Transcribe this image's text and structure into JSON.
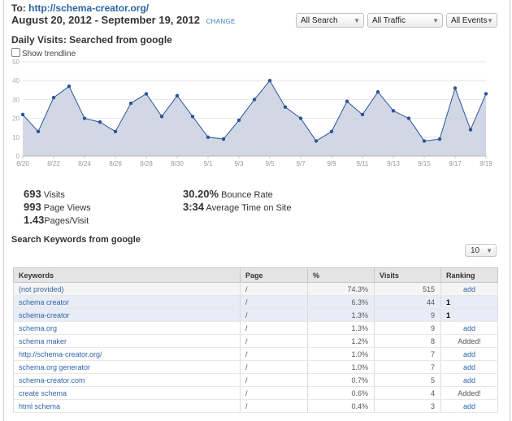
{
  "header": {
    "to_label": "To:",
    "site_url": "http://schema-creator.org/",
    "date_range": "August 20, 2012 - September 19, 2012",
    "change_label": "CHANGE"
  },
  "filters": [
    {
      "value": "All Search"
    },
    {
      "value": "All Traffic"
    },
    {
      "value": "All Events"
    }
  ],
  "chart_section": {
    "title": "Daily Visits: Searched from google",
    "trendline_label": "Show trendline"
  },
  "chart_data": {
    "type": "area",
    "title": "Daily Visits: Searched from google",
    "xlabel": "",
    "ylabel": "",
    "ylim": [
      0,
      50
    ],
    "yticks": [
      0,
      10,
      20,
      30,
      40,
      50
    ],
    "xtick_labels": [
      "8/20",
      "8/22",
      "8/24",
      "8/26",
      "8/28",
      "8/30",
      "9/1",
      "9/3",
      "9/5",
      "9/7",
      "9/9",
      "9/11",
      "9/13",
      "9/15",
      "9/17",
      "9/19"
    ],
    "x": [
      "8/20",
      "8/21",
      "8/22",
      "8/23",
      "8/24",
      "8/25",
      "8/26",
      "8/27",
      "8/28",
      "8/29",
      "8/30",
      "8/31",
      "9/1",
      "9/2",
      "9/3",
      "9/4",
      "9/5",
      "9/6",
      "9/7",
      "9/8",
      "9/9",
      "9/10",
      "9/11",
      "9/12",
      "9/13",
      "9/14",
      "9/15",
      "9/16",
      "9/17",
      "9/18",
      "9/19"
    ],
    "series": [
      {
        "values": [
          22,
          13,
          31,
          37,
          20,
          18,
          13,
          28,
          33,
          21,
          32,
          21,
          10,
          9,
          19,
          30,
          40,
          26,
          20,
          8,
          13,
          29,
          22,
          34,
          24,
          20,
          8,
          9,
          36,
          14,
          33
        ]
      }
    ],
    "grid": true,
    "colors": {
      "line": "#2b5597",
      "fill": "#c9d0e0",
      "grid": "#e6e6e6"
    }
  },
  "stats": {
    "visits_value": "693",
    "visits_label": "Visits",
    "pageviews_value": "993",
    "pageviews_label": "Page Views",
    "ppv_value": "1.43",
    "ppv_label": "Pages/Visit",
    "bounce_value": "30.20%",
    "bounce_label": "Bounce Rate",
    "time_value": "3:34",
    "time_label": "Average Time on Site"
  },
  "keywords_section": {
    "title": "Search Keywords from google",
    "rows_value": "10",
    "columns": [
      "Keywords",
      "Page",
      "%",
      "Visits",
      "Ranking"
    ],
    "rows": [
      {
        "keyword": "(not provided)",
        "page": "/",
        "pct": "74.3%",
        "visits": "515",
        "ranking": "add",
        "style": "gray"
      },
      {
        "keyword": "schema creator",
        "page": "/",
        "pct": "6.3%",
        "visits": "44",
        "ranking": "1",
        "style": "hl"
      },
      {
        "keyword": "schema-creator",
        "page": "/",
        "pct": "1.3%",
        "visits": "9",
        "ranking": "1",
        "style": "hl"
      },
      {
        "keyword": "schema.org",
        "page": "/",
        "pct": "1.3%",
        "visits": "9",
        "ranking": "add",
        "style": ""
      },
      {
        "keyword": "schema maker",
        "page": "/",
        "pct": "1.2%",
        "visits": "8",
        "ranking": "Added!",
        "style": ""
      },
      {
        "keyword": "http://schema-creator.org/",
        "page": "/",
        "pct": "1.0%",
        "visits": "7",
        "ranking": "add",
        "style": ""
      },
      {
        "keyword": "schema.org generator",
        "page": "/",
        "pct": "1.0%",
        "visits": "7",
        "ranking": "add",
        "style": ""
      },
      {
        "keyword": "schema-creator.com",
        "page": "/",
        "pct": "0.7%",
        "visits": "5",
        "ranking": "add",
        "style": ""
      },
      {
        "keyword": "create schema",
        "page": "/",
        "pct": "0.6%",
        "visits": "4",
        "ranking": "Added!",
        "style": ""
      },
      {
        "keyword": "html schema",
        "page": "/",
        "pct": "0.4%",
        "visits": "3",
        "ranking": "add",
        "style": ""
      }
    ]
  }
}
